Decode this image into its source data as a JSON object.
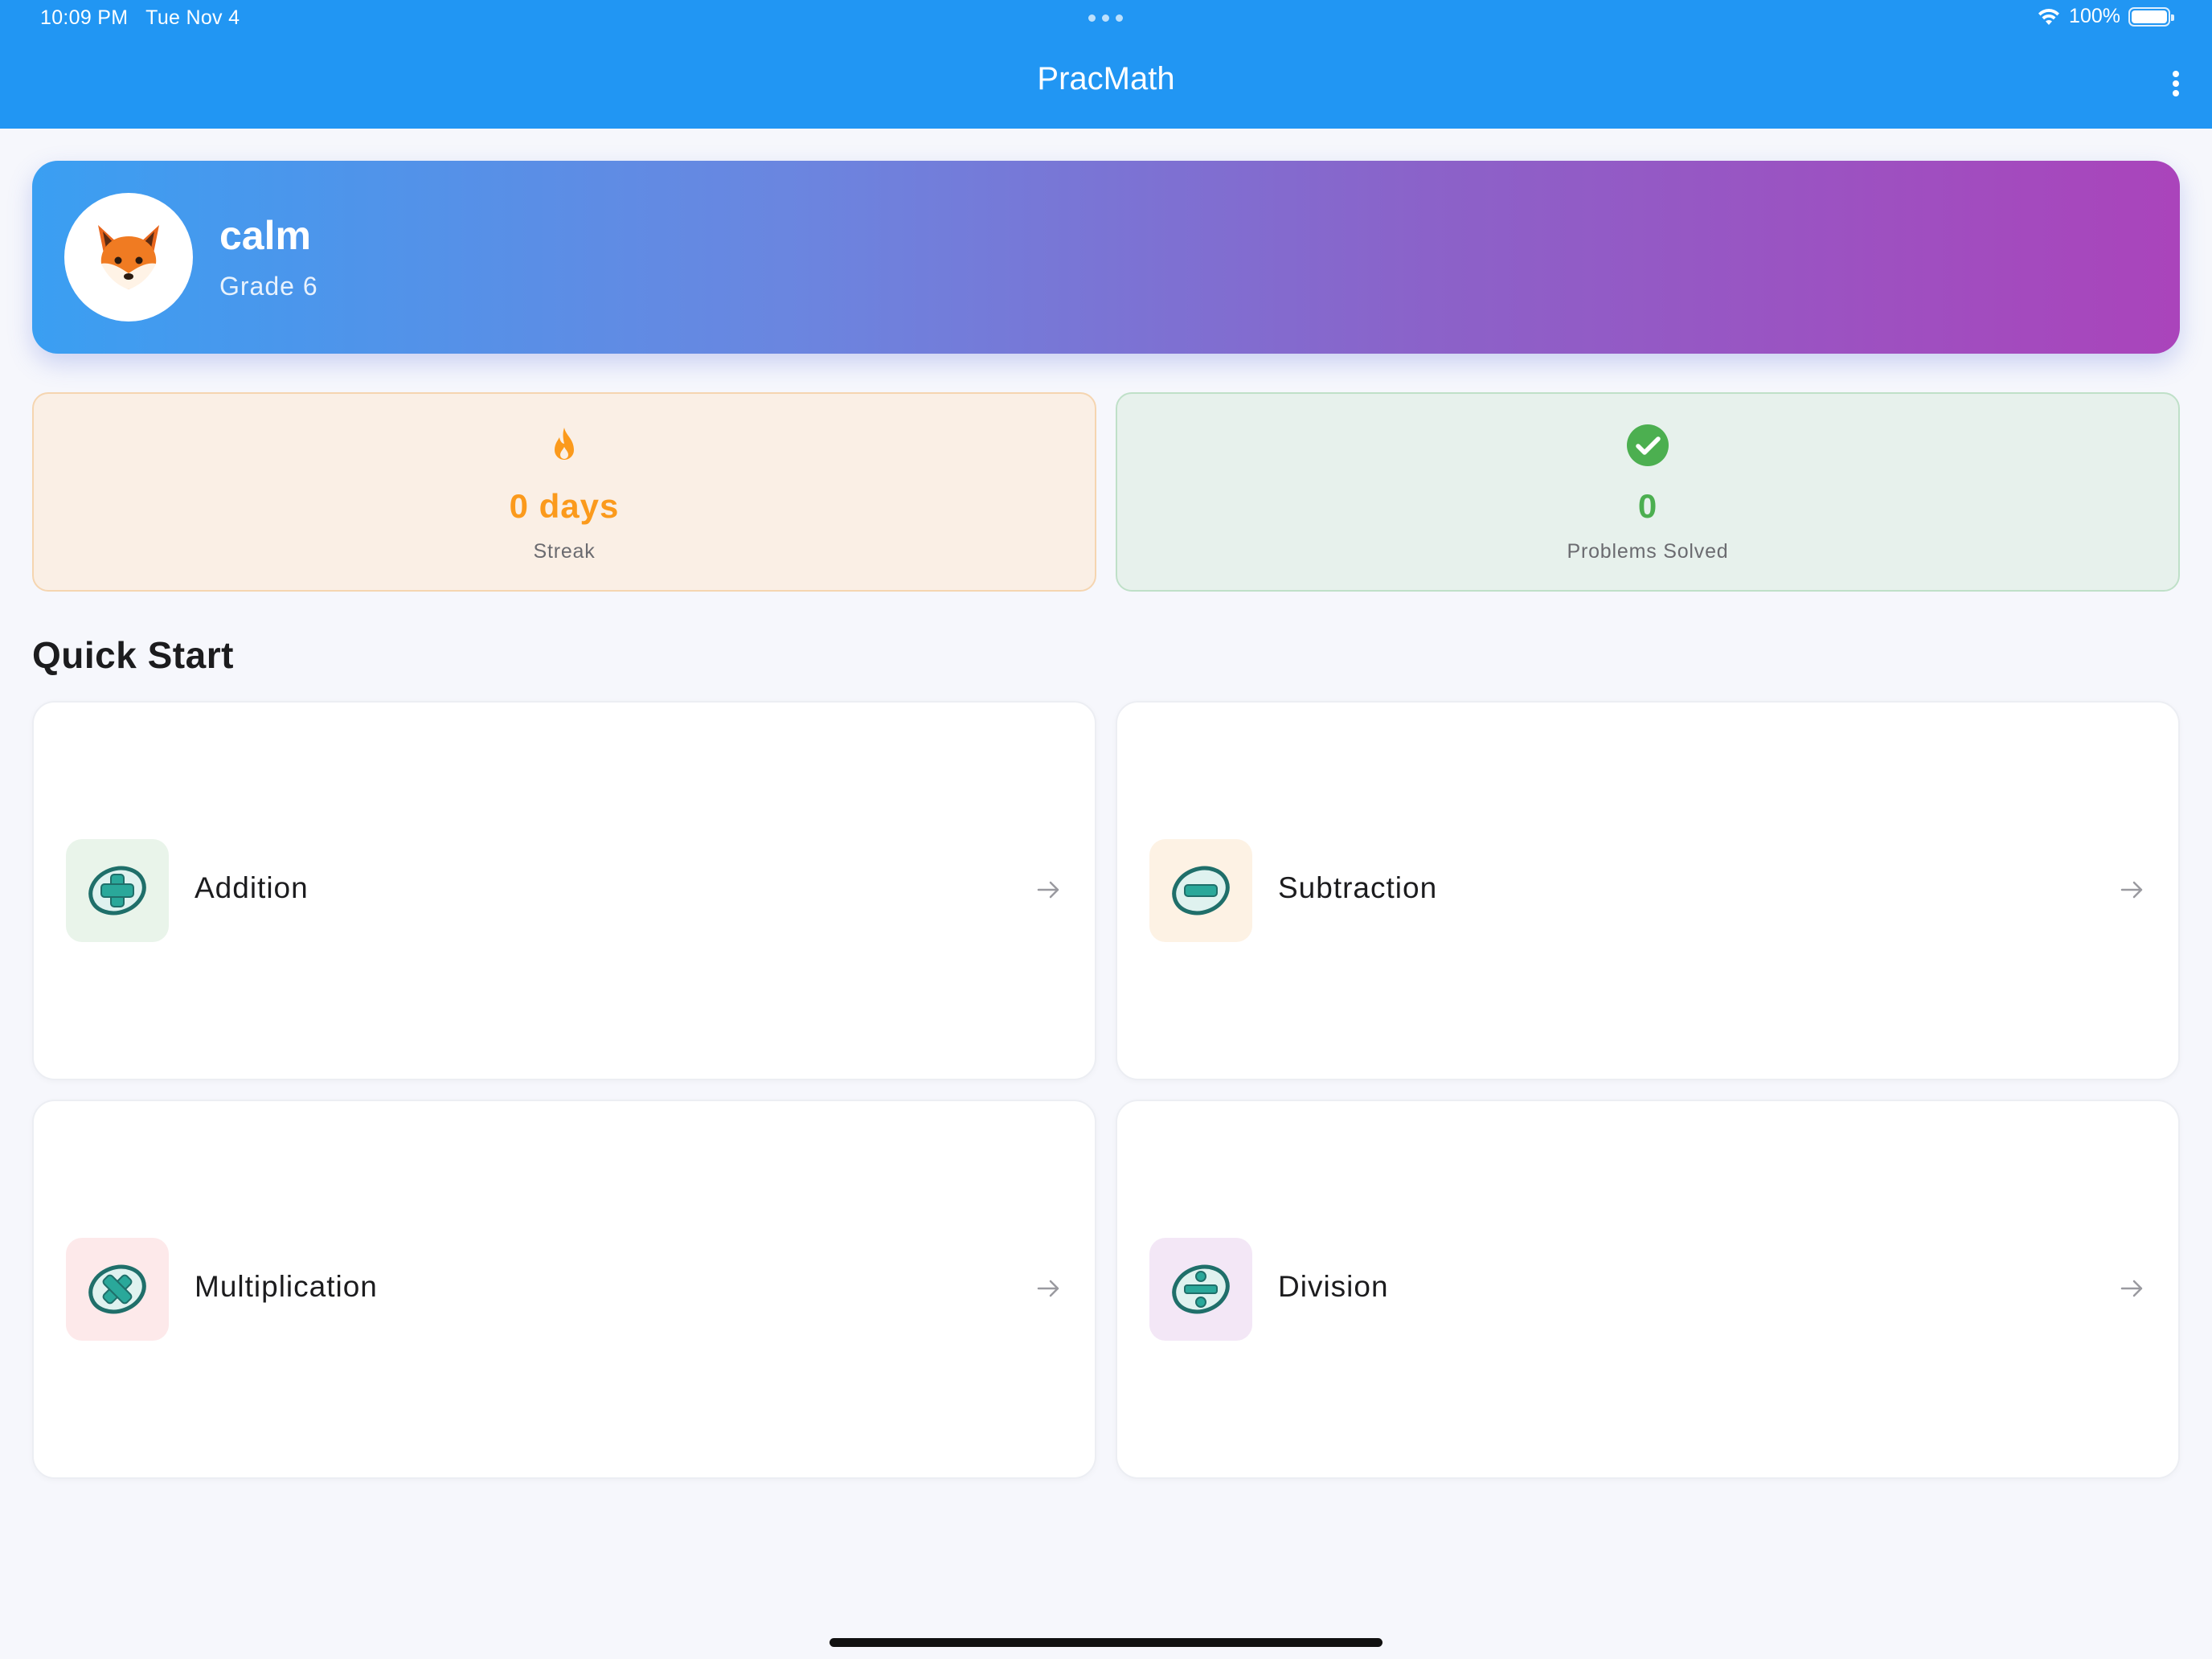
{
  "status_bar": {
    "time": "10:09 PM",
    "date": "Tue Nov 4",
    "battery": "100%"
  },
  "app": {
    "title": "PracMath",
    "menu_icon": "more-vertical-icon",
    "primary_color": "#2196f3"
  },
  "profile": {
    "name": "calm",
    "grade": "Grade 6",
    "avatar_icon": "fox-icon",
    "gradient": [
      "#3a9ff2",
      "#aa44bb"
    ]
  },
  "stats": {
    "streak": {
      "value": "0 days",
      "label": "Streak",
      "icon": "fire-icon",
      "color": "#fb9a1c"
    },
    "solved": {
      "value": "0",
      "label": "Problems Solved",
      "icon": "check-circle-icon",
      "color": "#4caf50"
    }
  },
  "quick_start": {
    "title": "Quick Start",
    "items": [
      {
        "label": "Addition",
        "icon": "plus-icon",
        "tint": "#e9f4ea"
      },
      {
        "label": "Subtraction",
        "icon": "minus-icon",
        "tint": "#fdf2e4"
      },
      {
        "label": "Multiplication",
        "icon": "times-icon",
        "tint": "#fde9ea"
      },
      {
        "label": "Division",
        "icon": "divide-icon",
        "tint": "#f3e7f6"
      }
    ]
  }
}
